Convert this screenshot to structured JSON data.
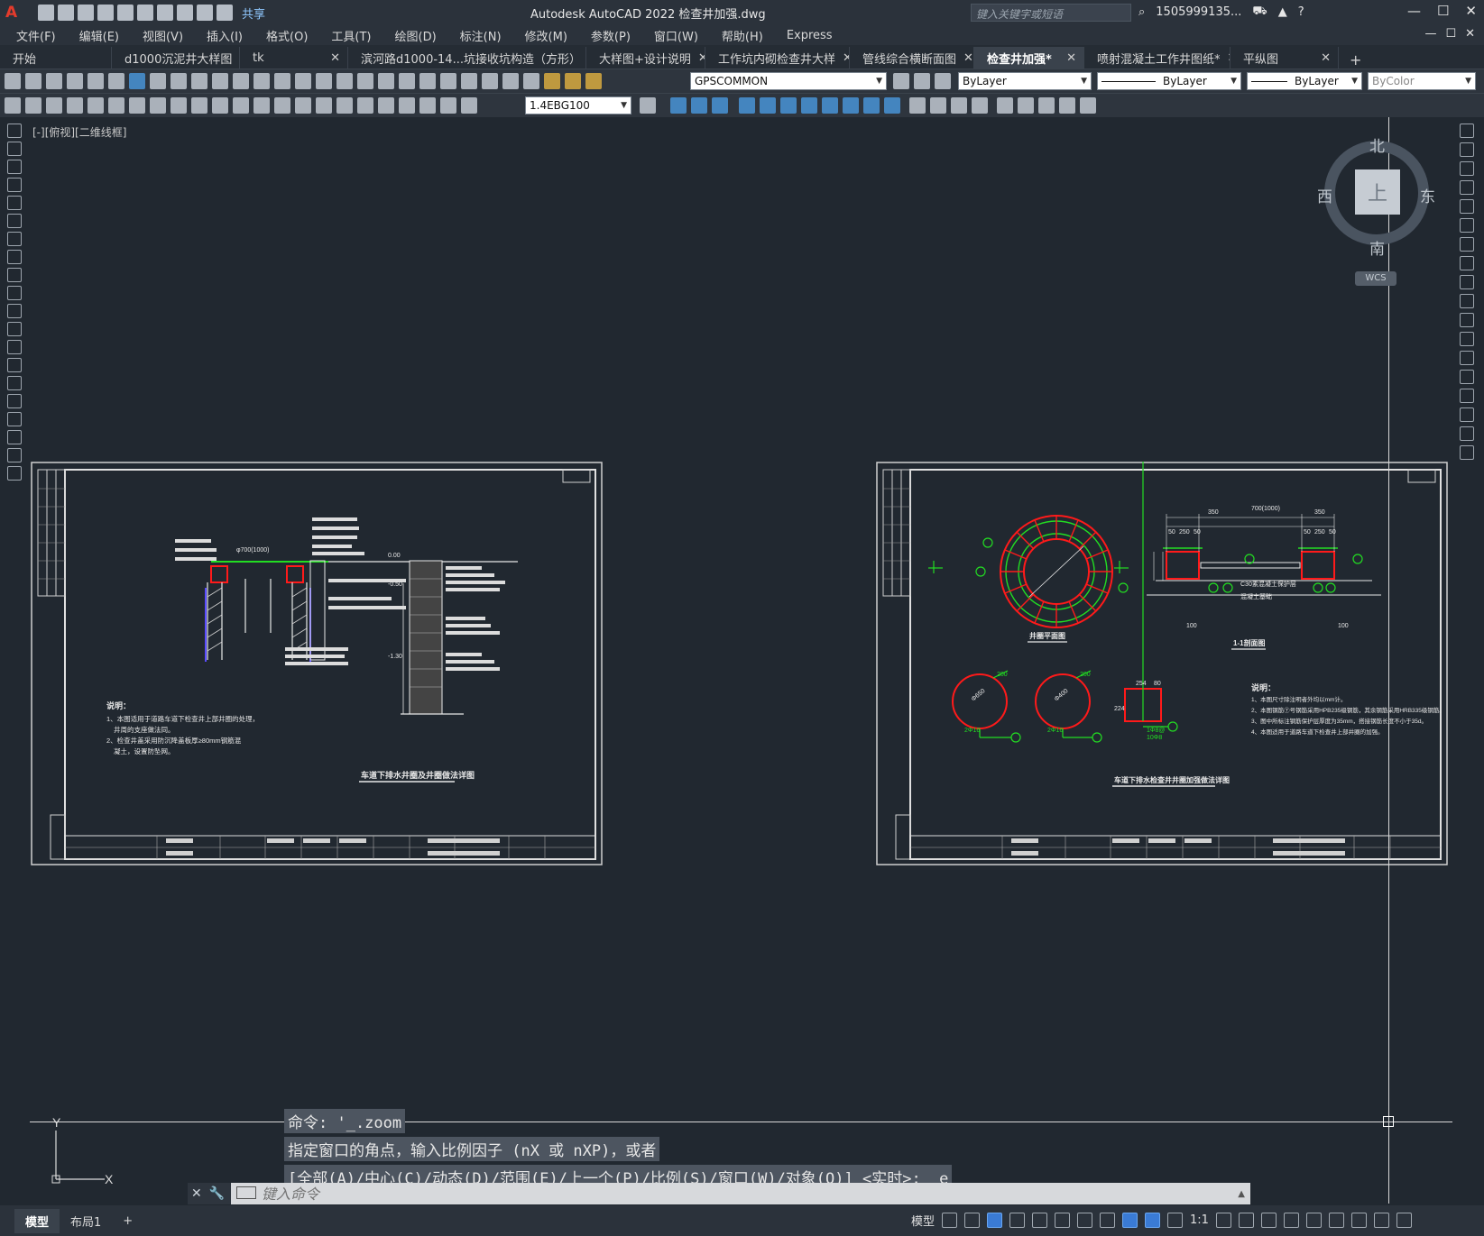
{
  "app": {
    "logo": "A",
    "title": "Autodesk AutoCAD 2022    检查井加强.dwg",
    "share": "共享",
    "search_placeholder": "键入关键字或短语",
    "user": "1505999135...",
    "window_controls": [
      "—",
      "☐",
      "✕"
    ]
  },
  "menu": {
    "items": [
      "文件(F)",
      "编辑(E)",
      "视图(V)",
      "插入(I)",
      "格式(O)",
      "工具(T)",
      "绘图(D)",
      "标注(N)",
      "修改(M)",
      "参数(P)",
      "窗口(W)",
      "帮助(H)",
      "Express"
    ],
    "right_controls": [
      "—",
      "☐",
      "✕"
    ]
  },
  "tabs": [
    {
      "label": "开始",
      "closable": false,
      "active": false
    },
    {
      "label": "d1000沉泥井大样图",
      "closable": true,
      "active": false
    },
    {
      "label": "tk",
      "closable": true,
      "active": false
    },
    {
      "label": "滨河路d1000-14...坑接收坑构造（方形）",
      "closable": true,
      "active": false
    },
    {
      "label": "大样图+设计说明",
      "closable": true,
      "active": false
    },
    {
      "label": "工作坑内砌检查井大样",
      "closable": true,
      "active": false
    },
    {
      "label": "管线综合横断面图",
      "closable": true,
      "active": false
    },
    {
      "label": "检查井加强*",
      "closable": true,
      "active": true
    },
    {
      "label": "喷射混凝土工作井图纸*",
      "closable": true,
      "active": false
    },
    {
      "label": "平纵图",
      "closable": true,
      "active": false
    }
  ],
  "tab_close": "✕",
  "tab_add": "+",
  "toolbar1": {
    "layer": "GPSCOMMON",
    "color": "ByLayer",
    "linetype": "ByLayer",
    "lineweight": "ByLayer",
    "plotstyle": "ByColor"
  },
  "toolbar2": {
    "dimstyle": "1.4EBG100"
  },
  "viewport_label": "[-][俯视][二维线框]",
  "viewcube": {
    "north": "北",
    "south": "南",
    "east": "东",
    "west": "西",
    "face": "上",
    "wcs": "WCS"
  },
  "ucs": {
    "x": "X",
    "y": "Y"
  },
  "command": {
    "history": [
      "命令: '_.zoom",
      "指定窗口的角点，输入比例因子 (nX 或 nXP)，或者",
      "[全部(A)/中心(C)/动态(D)/范围(E)/上一个(P)/比例(S)/窗口(W)/对象(O)] <实时>: _e"
    ],
    "placeholder": "键入命令"
  },
  "statusbar": {
    "layouts": [
      "模型",
      "布局1"
    ],
    "add": "+",
    "model": "模型",
    "scale": "1:1"
  },
  "drawing1": {
    "title": "车道下排水井圈及井圈做法详图",
    "notes_title": "说明：",
    "notes": [
      "1、本图适用于道路车道下检查井上部井圈的处理，",
      "井周的支座做法同。",
      "2、检查井盖采用防沉降盖板厚≥80mm钢筋混",
      "凝土，设置防坠网。"
    ],
    "dim": "φ700(1000)",
    "levels": [
      "0.00",
      "-0.50",
      "-1.30"
    ]
  },
  "drawing2": {
    "plan_title": "井圈平面图",
    "section_title": "1-1剖面图",
    "main_title": "车道下排水检查井井圈加强做法详图",
    "dims_top": [
      "350",
      "700(1000)",
      "350"
    ],
    "dims_sub": [
      "50",
      "250",
      "50",
      "50",
      "250",
      "50"
    ],
    "dims_bottom": [
      "100",
      "100"
    ],
    "rebar_labels": [
      "⑤",
      "⑥",
      "⑦"
    ],
    "details": [
      "200",
      "Φ650",
      "200",
      "Φ400",
      "254",
      "80",
      "224"
    ],
    "rebar_notes": [
      "2Φ16",
      "2Φ16",
      "1Φ8@",
      "10Φ8"
    ],
    "notes_title": "说明：",
    "notes": [
      "1、本图尺寸除注明者外均以mm计。",
      "2、本图钢筋⑦号钢筋采用HPB235级钢筋，其余钢筋采用HRB335级钢筋。",
      "3、图中所标注钢筋保护层厚度为35mm，搭接钢筋长度不小于35d。",
      "4、本图适用于道路车道下检查井上部井圈的加强。"
    ],
    "annot1": "C30素混凝土保护层",
    "annot2": "混凝土基础"
  },
  "colors": {
    "canvas": "#212830",
    "red": "#ff1a1a",
    "green": "#22dd22",
    "white": "#e8e8e8",
    "accent": "#3a7bd5"
  }
}
